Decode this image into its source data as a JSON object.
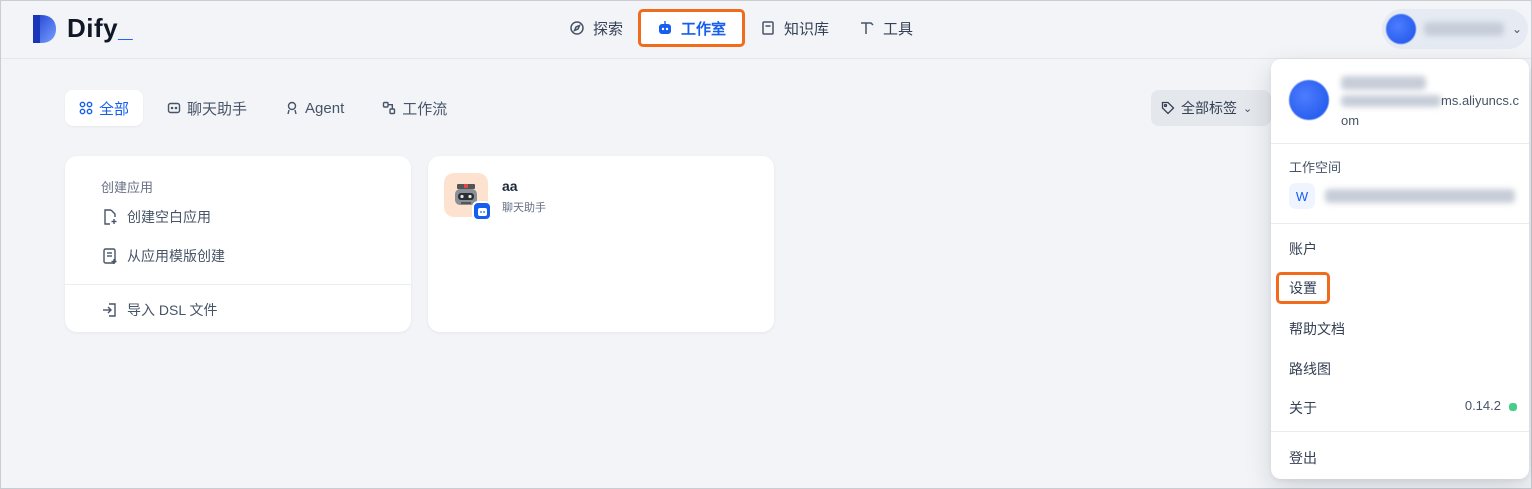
{
  "brand": {
    "name": "Dify",
    "underscore": "_"
  },
  "nav": {
    "explore": "探索",
    "studio": "工作室",
    "knowledge": "知识库",
    "tools": "工具"
  },
  "tabs": {
    "all": "全部",
    "chat": "聊天助手",
    "agent": "Agent",
    "workflow": "工作流"
  },
  "tag_filter": "全部标签",
  "create_card": {
    "title": "创建应用",
    "blank": "创建空白应用",
    "template": "从应用模版创建",
    "import": "导入 DSL 文件"
  },
  "apps": [
    {
      "name": "aa",
      "type": "聊天助手"
    }
  ],
  "dropdown": {
    "email_tail": "ms.aliyuncs.com",
    "workspace_label": "工作空间",
    "workspace_initial": "W",
    "account": "账户",
    "settings": "设置",
    "help": "帮助文档",
    "roadmap": "路线图",
    "about": "关于",
    "version": "0.14.2",
    "logout": "登出"
  },
  "colors": {
    "accent": "#155eef",
    "highlight_box": "#f26b1d",
    "status_ok": "#47cd89"
  }
}
